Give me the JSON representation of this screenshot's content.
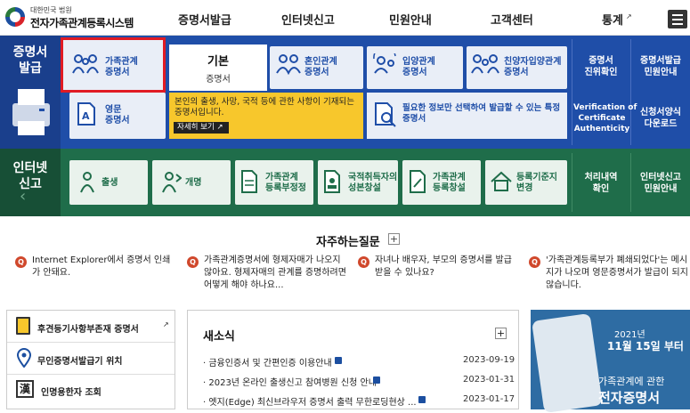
{
  "header": {
    "logo_small": "대한민국 법원",
    "logo_big": "전자가족관계등록시스템",
    "nav": [
      "증명서발급",
      "인터넷신고",
      "민원안내",
      "고객센터",
      "통계"
    ]
  },
  "cert": {
    "section_title": "증명서 발급",
    "tiles": [
      {
        "label": "가족관계\n증명서"
      },
      {
        "label": "혼인관계\n증명서"
      },
      {
        "label": "입양관계\n증명서"
      },
      {
        "label": "친양자입양관계\n증명서"
      }
    ],
    "basic": {
      "title": "기본",
      "sub": "증명서",
      "desc": "본인의 출생, 사망, 국적 등에 관한 사항이 기재되는 증명서입니다.",
      "detail": "자세히 보기"
    },
    "english": {
      "label": "영문\n증명서"
    },
    "select": {
      "text": "필요한 정보만 선택하여 발급할 수 있는 특정증명서"
    },
    "right_links": [
      "증명서\n진위확인",
      "증명서발급\n민원안내",
      "Verification of\nCertificate\nAuthenticity",
      "신청서양식\n다운로드"
    ]
  },
  "report": {
    "section_title": "인터넷 신고",
    "tiles": [
      "출생",
      "개명",
      "가족관계\n등록부정정",
      "국적취득자의\n성본창설",
      "가족관계\n등록창설",
      "등록기준지\n변경"
    ],
    "right_links": [
      "처리내역\n확인",
      "인터넷신고\n민원안내"
    ]
  },
  "faq": {
    "title": "자주하는질문",
    "items": [
      "Internet Explorer에서 증명서 인쇄가 안돼요.",
      "가족관계증명서에 형제자매가 나오지 않아요. 형제자매의 관계를 증명하려면 어떻게 해야 하나요...",
      "자녀나 배우자, 부모의 증명서를 발급 받을 수 있나요?",
      "'가족관계등록부가 폐쇄되었다'는 메시지가 나오며 영문증명서가 발급이 되지 않습니다."
    ]
  },
  "side_links": [
    "후견등기사항부존재 증명서",
    "무인증명서발급기 위치",
    "인명용한자 조회"
  ],
  "news": {
    "title": "새소식",
    "items": [
      {
        "text": "금융인증서 및 간편인증 이용안내",
        "date": "2023-09-19"
      },
      {
        "text": "2023년 온라인 출생신고 참여병원 신청 안내",
        "date": "2023-01-31"
      },
      {
        "text": "엣지(Edge) 최신브라우저 증명서 출력 무한로딩현상 ...",
        "date": "2023-01-17"
      }
    ]
  },
  "banner": {
    "year": "2021년",
    "date": "11월 15일 부터",
    "sub": "가족관계에 관한",
    "big": "전자증명서"
  },
  "colors": {
    "blue": "#1f4ea8",
    "green": "#1f6d4a",
    "highlight": "#e01b24",
    "yellow": "#f7c72c"
  }
}
